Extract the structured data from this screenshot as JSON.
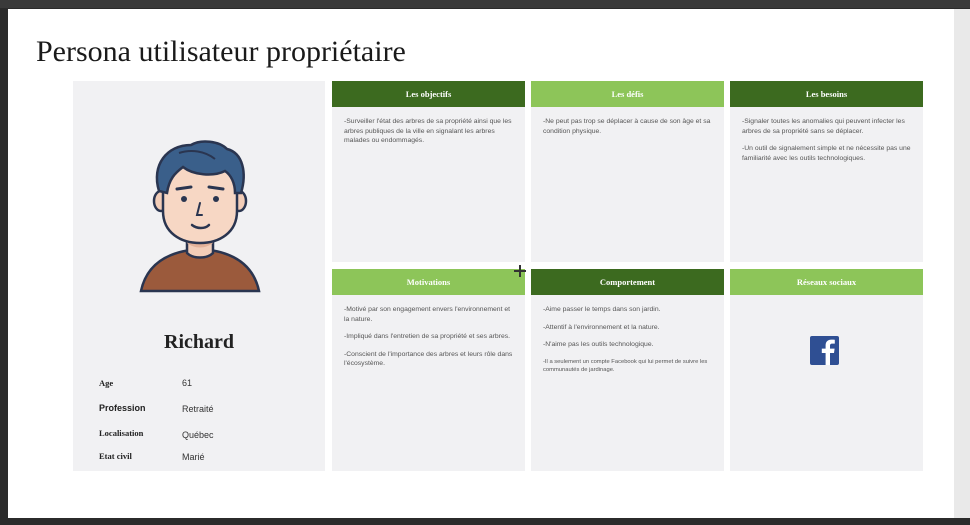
{
  "slide": {
    "title": "Persona utilisateur propriétaire"
  },
  "profile": {
    "name": "Richard",
    "avatar_icon": "man-avatar-icon",
    "fields": [
      {
        "label": "Age",
        "value": "61"
      },
      {
        "label": "Profession",
        "value": "Retraité"
      },
      {
        "label": "Localisation",
        "value": "Québec"
      },
      {
        "label": "Etat civil",
        "value": "Marié"
      }
    ]
  },
  "cards": {
    "objectifs": {
      "title": "Les objectifs",
      "items": [
        "-Surveiller l'état des arbres de sa propriété ainsi que les arbres publiques de la ville en signalant les arbres malades ou endommagés."
      ]
    },
    "defis": {
      "title": "Les défis",
      "items": [
        "-Ne peut pas trop se déplacer à cause de son âge et sa condition physique."
      ]
    },
    "besoins": {
      "title": "Les besoins",
      "items": [
        "-Signaler toutes les anomalies qui peuvent infecter les arbres de sa propriété sans se déplacer.",
        "-Un outil de signalement simple et ne nécessite pas une familiarité avec les outils technologiques."
      ]
    },
    "motivations": {
      "title": "Motivations",
      "items": [
        "-Motivé par son engagement envers l'environnement et la nature.",
        "-Impliqué dans l'entretien de sa propriété et ses arbres.",
        "-Conscient de l'importance des arbres et leurs rôle dans l'écosystème."
      ]
    },
    "comportement": {
      "title": "Comportement",
      "items": [
        "-Aime passer le temps dans son jardin.",
        "-Attentif à l'environnement et la nature.",
        "-N'aime pas les outils technologique.",
        "-Il a seulement un compte Facebook qui lui permet de suivre les communautés de jardinage."
      ]
    },
    "reseaux": {
      "title": "Réseaux sociaux",
      "icon": "facebook-icon"
    }
  },
  "colors": {
    "header_dark": "#3c6a1f",
    "header_light": "#8dc559",
    "card_bg": "#f1f1f3",
    "facebook": "#2f4f93"
  }
}
